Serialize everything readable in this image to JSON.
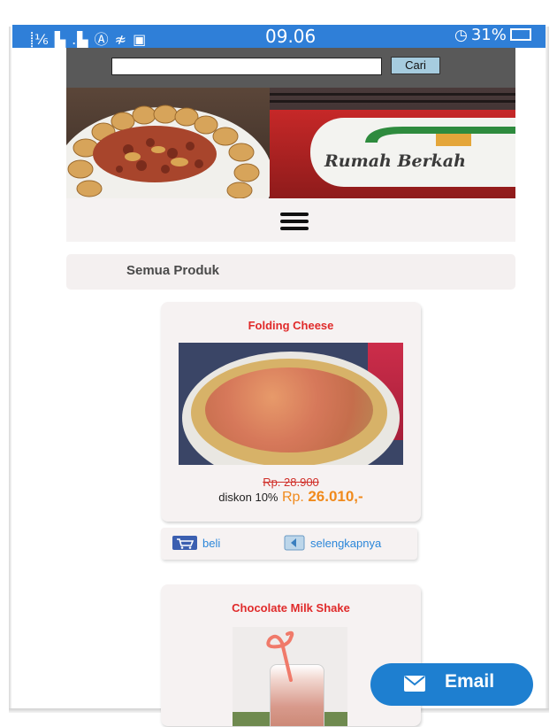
{
  "status_bar": {
    "signal_text": "⸽⅙ ▙ .▙ Ⓐ ≉ ▣",
    "time": "09.06",
    "battery": "31%"
  },
  "search": {
    "value": "",
    "button_label": "Cari"
  },
  "banner": {
    "sign_text": "Rumah Berkah"
  },
  "category": {
    "label": "Semua Produk"
  },
  "products": [
    {
      "name": "Folding Cheese",
      "old_price": "Rp. 28.900",
      "discount_label": "diskon 10%",
      "price_prefix": "Rp.",
      "new_price": "26.010,-",
      "buy_label": "beli",
      "more_label": "selengkapnya"
    },
    {
      "name": "Chocolate Milk Shake"
    }
  ],
  "email_button": {
    "label": "Email"
  },
  "colors": {
    "status_bar": "#2f7fd8",
    "header": "#595959",
    "product_title": "#e02a2a",
    "price_new": "#f08a1c",
    "link": "#2b86d9",
    "email_button": "#1e7fd0"
  },
  "icons": [
    "alarm-icon",
    "battery-icon",
    "menu-icon",
    "cart-icon",
    "more-icon",
    "email-icon"
  ]
}
